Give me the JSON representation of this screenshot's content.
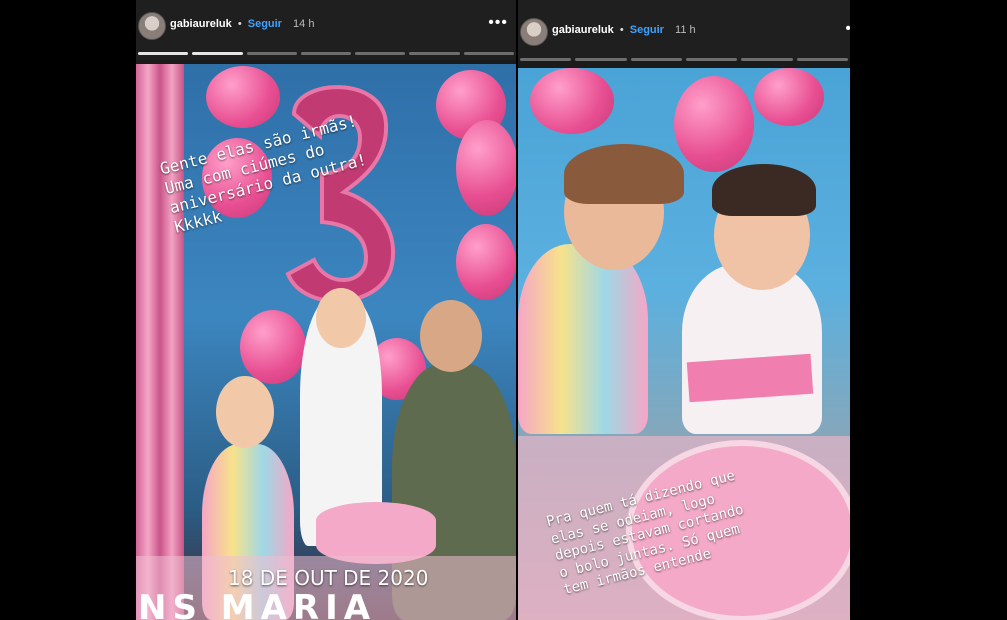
{
  "stories": [
    {
      "username": "gabiaureluk",
      "separator": "•",
      "follow_label": "Seguir",
      "time": "14 h",
      "more_label": "•••",
      "progress": {
        "total": 7,
        "done": 2
      },
      "caption": "Gente elas são irmãs!\nUma com ciúmes do\naniversário da outra!\nKkkkk",
      "date_text": "18 DE OUT DE 2020",
      "banner_text": "NS MARIA"
    },
    {
      "username": "gabiaureluk",
      "separator": "•",
      "follow_label": "Seguir",
      "time": "11 h",
      "more_label": "•",
      "progress": {
        "total": 6,
        "done": 0
      },
      "caption": "Pra quem tá dizendo que\nelas se odeiam, logo\ndepois estavam cortando\no bolo juntas. Só quem\ntem irmãos entende"
    }
  ],
  "colors": {
    "follow": "#3ea3ff",
    "balloon": "#e84f92",
    "background": "#000000"
  }
}
